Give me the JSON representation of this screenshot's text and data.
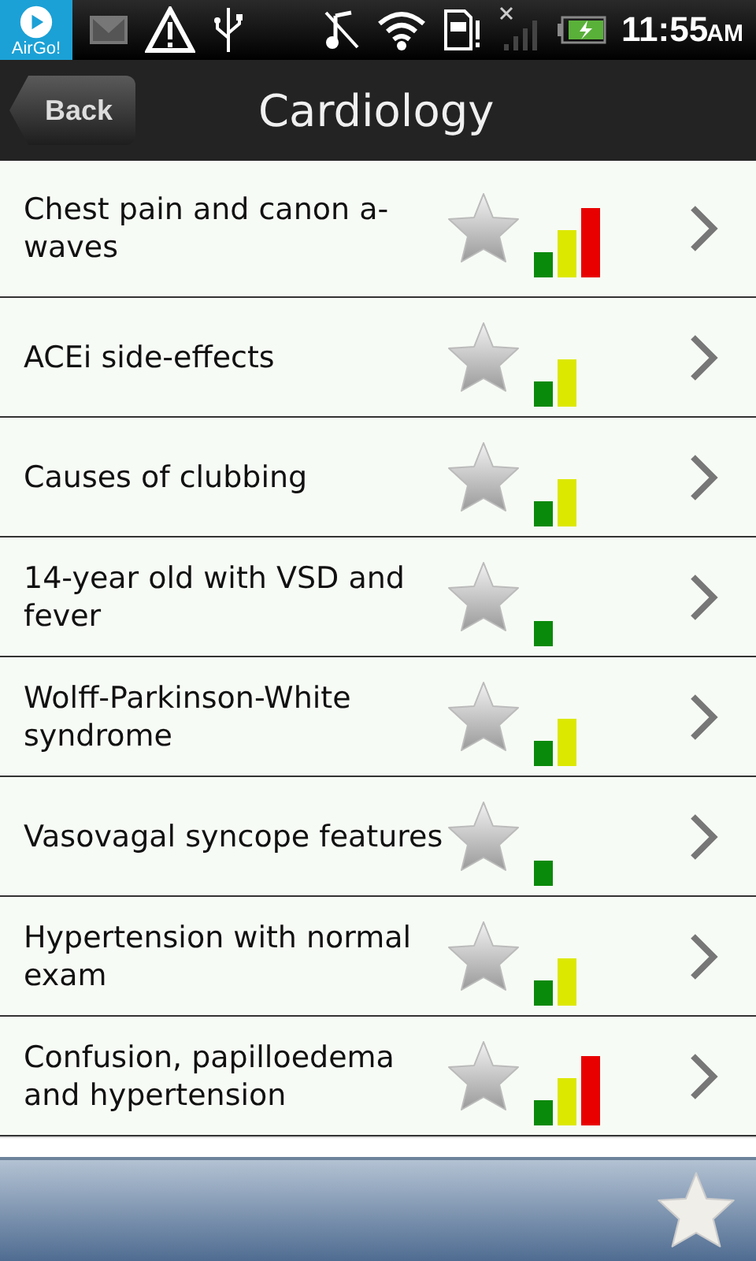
{
  "status_bar": {
    "app_label": "AirGo!",
    "time": "11:55",
    "meridiem": "AM"
  },
  "header": {
    "back": "Back",
    "title": "Cardiology"
  },
  "items": [
    {
      "title": "Chest pain and canon a-waves",
      "kind": "hard",
      "starred": false
    },
    {
      "title": "ACEi side-effects",
      "kind": "medium",
      "starred": false
    },
    {
      "title": "Causes of clubbing",
      "kind": "medium",
      "starred": false
    },
    {
      "title": "14-year old with VSD and fever",
      "kind": "easy",
      "starred": false
    },
    {
      "title": "Wolff-Parkinson-White syndrome",
      "kind": "medium",
      "starred": false
    },
    {
      "title": "Vasovagal syncope features",
      "kind": "easy",
      "starred": false
    },
    {
      "title": "Hypertension with normal exam",
      "kind": "medium",
      "starred": false
    },
    {
      "title": "Confusion, papilloedema and hypertension",
      "kind": "hard",
      "starred": false
    }
  ]
}
